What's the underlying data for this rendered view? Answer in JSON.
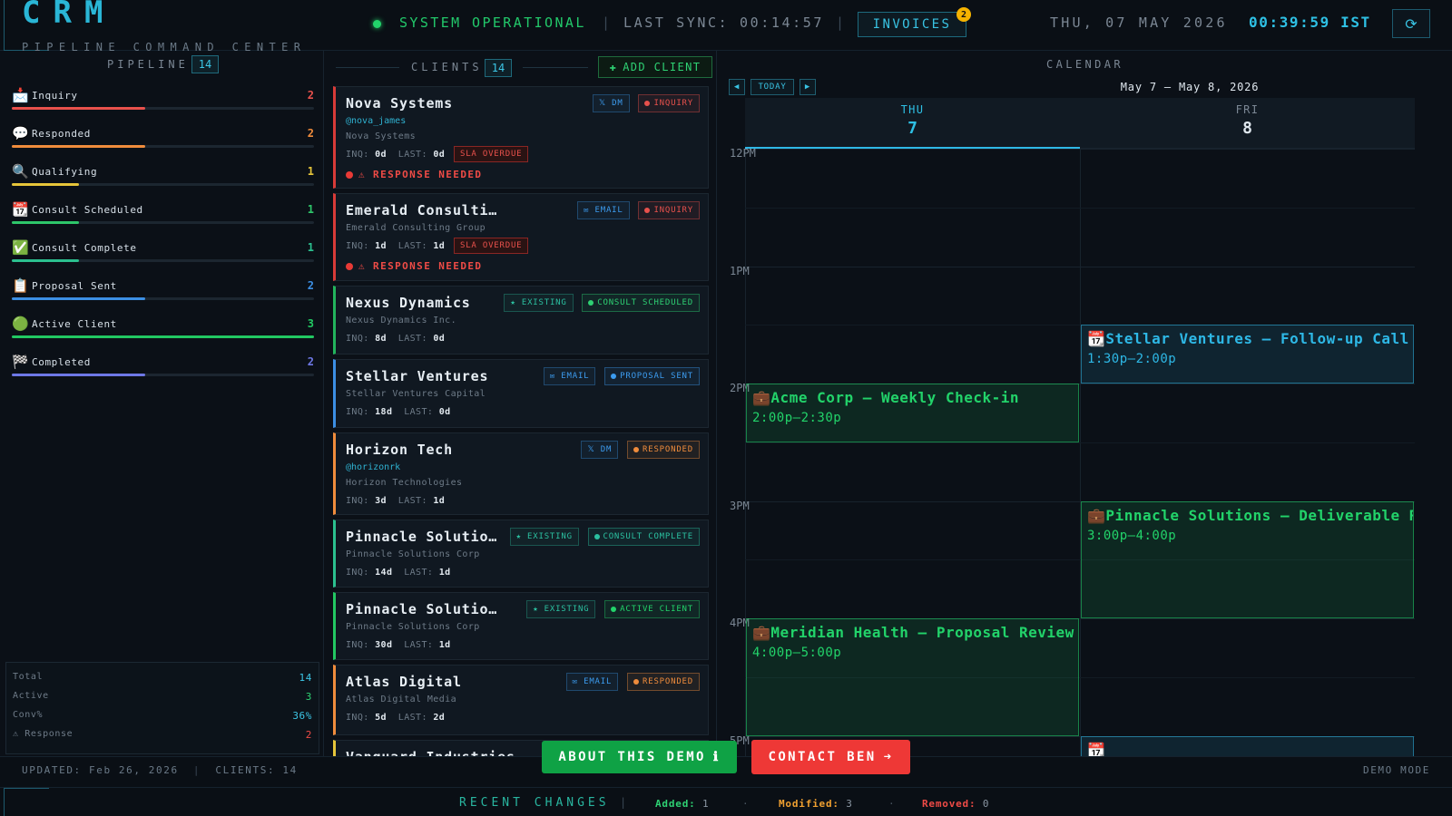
{
  "header": {
    "logo": "CRM",
    "subtitle": "PIPELINE COMMAND CENTER",
    "status": "SYSTEM OPERATIONAL",
    "separator": "|",
    "last_sync": "LAST SYNC: 00:14:57",
    "invoices_label": "INVOICES",
    "invoices_badge": "2",
    "date": "THU, 07 MAY 2026",
    "time": "00:39:59 IST",
    "refresh_icon": "⟳"
  },
  "pipeline": {
    "title": "PIPELINE",
    "count": "14",
    "stages": [
      {
        "icon": "📩",
        "label": "Inquiry",
        "count": "2",
        "fraction": 0.657,
        "color": "#e8514c"
      },
      {
        "icon": "💬",
        "label": "Responded",
        "count": "2",
        "fraction": 0.657,
        "color": "#f08c3c"
      },
      {
        "icon": "🔍",
        "label": "Qualifying",
        "count": "1",
        "fraction": 0.33,
        "color": "#e6c53a"
      },
      {
        "icon": "📆",
        "label": "Consult Scheduled",
        "count": "1",
        "fraction": 0.33,
        "color": "#2ec66a"
      },
      {
        "icon": "✅",
        "label": "Consult Complete",
        "count": "1",
        "fraction": 0.33,
        "color": "#2bc08f"
      },
      {
        "icon": "📋",
        "label": "Proposal Sent",
        "count": "2",
        "fraction": 0.657,
        "color": "#3c8fe4"
      },
      {
        "icon": "🟢",
        "label": "Active Client",
        "count": "3",
        "fraction": 1.0,
        "color": "#22c862"
      },
      {
        "icon": "🏁",
        "label": "Completed",
        "count": "2",
        "fraction": 0.657,
        "color": "#6e78e6"
      }
    ],
    "stats": [
      {
        "label": "Total",
        "value": "14",
        "color": "#3cc6e6"
      },
      {
        "label": "Active",
        "value": "3",
        "color": "#2ed173"
      },
      {
        "label": "Conv%",
        "value": "36%",
        "color": "#3cc6e6"
      },
      {
        "label": "⚠ Response",
        "value": "2",
        "color": "#ef4b46"
      }
    ]
  },
  "clients": {
    "title": "CLIENTS",
    "count": "14",
    "add_label": "ADD CLIENT",
    "add_icon": "✚",
    "cards": [
      {
        "name": "Nova Systems",
        "handle": "@nova_james",
        "company": "Nova Systems",
        "inq": "0d",
        "last": "0d",
        "sla": "SLA OVERDUE",
        "response": "⚠ RESPONSE NEEDED",
        "source": "𝕏 DM",
        "stage": "INQUIRY",
        "border": "#d83b38"
      },
      {
        "name": "Emerald Consulting",
        "handle": "",
        "company": "Emerald Consulting Group",
        "inq": "1d",
        "last": "1d",
        "sla": "SLA OVERDUE",
        "response": "⚠ RESPONSE NEEDED",
        "source": "✉ EMAIL",
        "stage": "INQUIRY",
        "border": "#d83b38"
      },
      {
        "name": "Nexus Dynamics",
        "handle": "",
        "company": "Nexus Dynamics Inc.",
        "inq": "8d",
        "last": "0d",
        "sla": "",
        "response": "",
        "source": "★ EXISTING",
        "stage": "CONSULT SCHEDULED",
        "border": "#22b45c"
      },
      {
        "name": "Stellar Ventures",
        "handle": "",
        "company": "Stellar Ventures Capital",
        "inq": "18d",
        "last": "0d",
        "sla": "",
        "response": "",
        "source": "✉ EMAIL",
        "stage": "PROPOSAL SENT",
        "border": "#3c8fe4"
      },
      {
        "name": "Horizon Tech",
        "handle": "@horizonrk",
        "company": "Horizon Technologies",
        "inq": "3d",
        "last": "1d",
        "sla": "",
        "response": "",
        "source": "𝕏 DM",
        "stage": "RESPONDED",
        "border": "#f08c3c"
      },
      {
        "name": "Pinnacle Solutions",
        "handle": "",
        "company": "Pinnacle Solutions Corp",
        "inq": "14d",
        "last": "1d",
        "sla": "",
        "response": "",
        "source": "★ EXISTING",
        "stage": "CONSULT COMPLETE",
        "border": "#2bc08f"
      },
      {
        "name": "Pinnacle Solutions",
        "handle": "",
        "company": "Pinnacle Solutions Corp",
        "inq": "30d",
        "last": "1d",
        "sla": "",
        "response": "",
        "source": "★ EXISTING",
        "stage": "ACTIVE CLIENT",
        "border": "#22c862"
      },
      {
        "name": "Atlas Digital",
        "handle": "",
        "company": "Atlas Digital Media",
        "inq": "5d",
        "last": "2d",
        "sla": "",
        "response": "",
        "source": "✉ EMAIL",
        "stage": "RESPONDED",
        "border": "#f08c3c"
      },
      {
        "name": "Vanguard Industries",
        "handle": "",
        "company": "",
        "inq": "",
        "last": "",
        "sla": "",
        "response": "",
        "source": "",
        "stage": "",
        "border": "#e6c53a"
      }
    ]
  },
  "calendar": {
    "title": "CALENDAR",
    "prev_icon": "◀",
    "today_label": "TODAY",
    "next_icon": "▶",
    "range": "May 7 – May 8, 2026",
    "days": [
      {
        "name": "THU",
        "num": "7"
      },
      {
        "name": "FRI",
        "num": "8"
      }
    ],
    "hours": [
      "12PM",
      "1PM",
      "2PM",
      "3PM",
      "4PM",
      "5PM"
    ],
    "events": [
      {
        "icon": "📆",
        "title": "Stellar Ventures — Follow-up Call",
        "time": "1:30p–2:00p",
        "day": 1,
        "start": 1.5,
        "end": 2.0,
        "color": "#2eb8e6"
      },
      {
        "icon": "💼",
        "title": "Acme Corp — Weekly Check-in",
        "time": "2:00p–2:30p",
        "day": 0,
        "start": 2.0,
        "end": 2.5,
        "color": "#22d36a"
      },
      {
        "icon": "💼",
        "title": "Pinnacle Solutions — Deliverable R…",
        "time": "3:00p–4:00p",
        "day": 1,
        "start": 3.0,
        "end": 4.0,
        "color": "#22d36a"
      },
      {
        "icon": "💼",
        "title": "Meridian Health — Proposal Review",
        "time": "4:00p–5:00p",
        "day": 0,
        "start": 4.0,
        "end": 5.0,
        "color": "#22d36a"
      },
      {
        "icon": "📆",
        "title": "",
        "time": "",
        "day": 1,
        "start": 5.0,
        "end": 5.5,
        "color": "#2eb8e6"
      }
    ]
  },
  "footer": {
    "updated": "UPDATED: Feb 26, 2026",
    "clients": "CLIENTS: 14",
    "demo_mode": "DEMO MODE",
    "recent_title": "RECENT CHANGES",
    "added_label": "Added:",
    "added": "1",
    "modified_label": "Modified:",
    "modified": "3",
    "removed_label": "Removed:",
    "removed": "0",
    "dot": "·"
  },
  "actions": {
    "about_label": "ABOUT THIS DEMO",
    "about_icon": "ℹ",
    "contact_label": "CONTACT BEN",
    "contact_icon": "➜"
  },
  "stage_colors": {
    "INQUIRY": "#e8514c",
    "RESPONDED": "#f08c3c",
    "CONSULT SCHEDULED": "#2ed173",
    "CONSULT COMPLETE": "#2bc0a0",
    "PROPOSAL SENT": "#3c9cf0",
    "ACTIVE CLIENT": "#22d36a"
  },
  "source_colors": {
    "𝕏 DM": "#3c9cf0",
    "✉ EMAIL": "#3c9cf0",
    "★ EXISTING": "#2bc0a0"
  }
}
